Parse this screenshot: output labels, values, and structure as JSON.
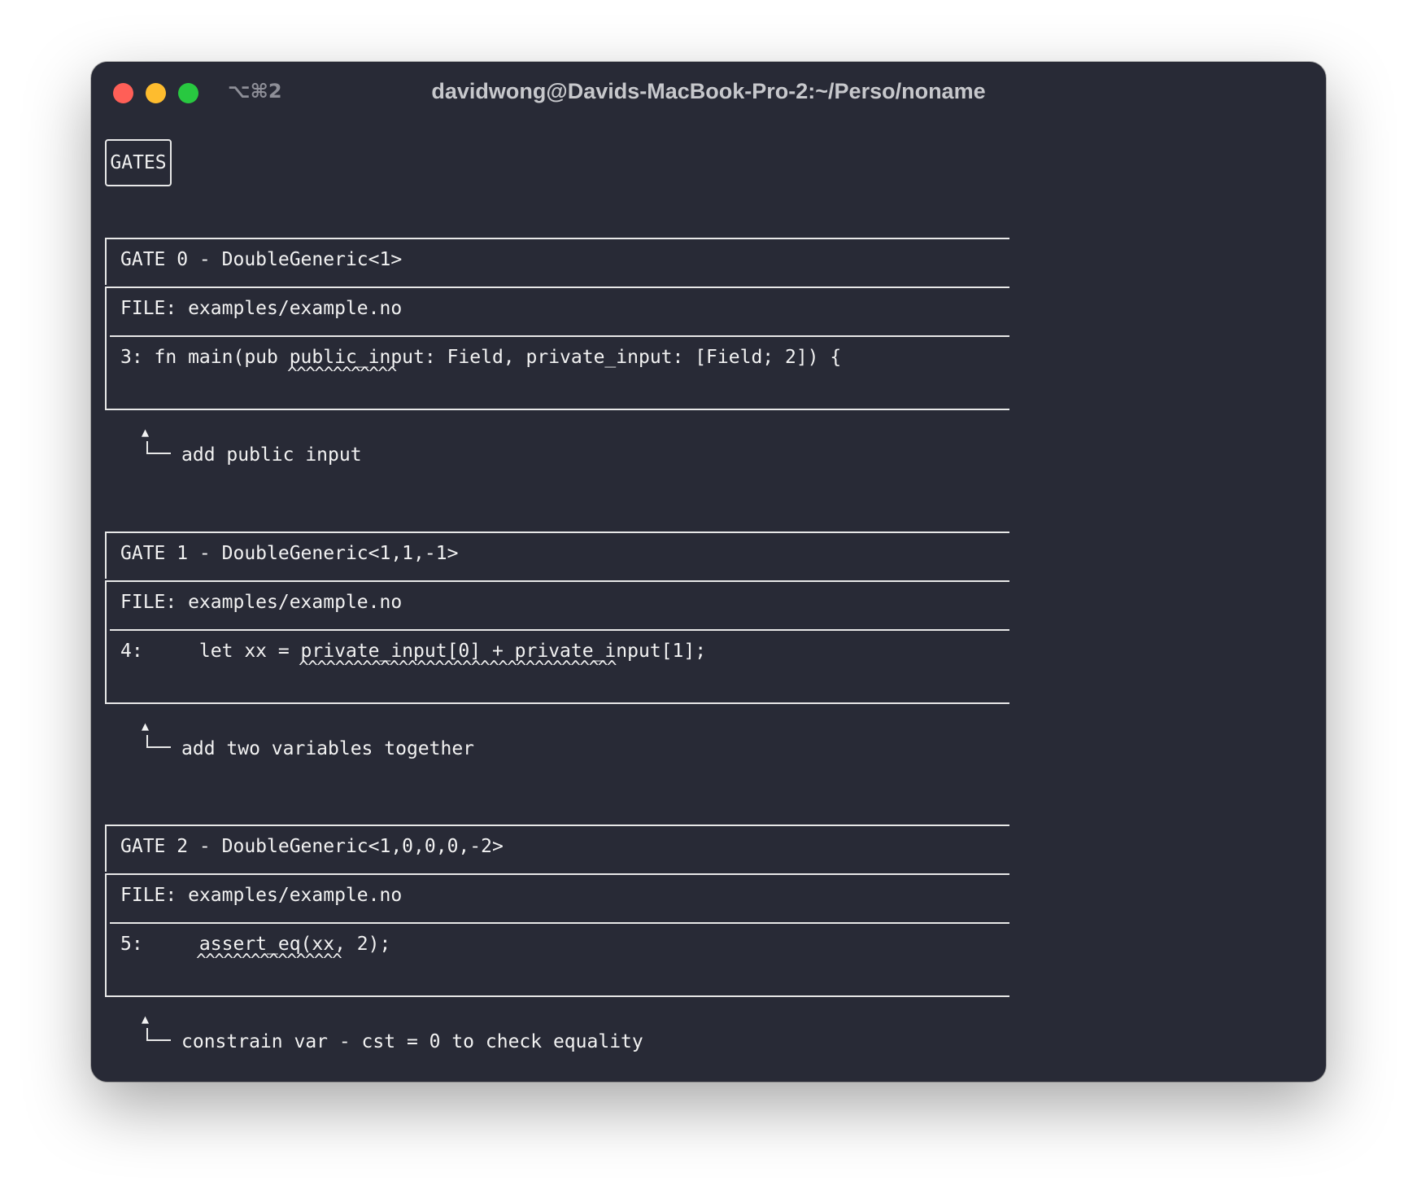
{
  "window": {
    "shortcut": "⌥⌘2",
    "title": "davidwong@Davids-MacBook-Pro-2:~/Perso/noname"
  },
  "tag": "GATES",
  "gates": [
    {
      "header": "GATE 0 - DoubleGeneric<1>",
      "file": "FILE: examples/example.no",
      "code": "3: fn main(pub public_input: Field, private_input: [Field; 2]) {",
      "carets": "^^^^^^^^^^^^",
      "note": "add public input"
    },
    {
      "header": "GATE 1 - DoubleGeneric<1,1,-1>",
      "file": "FILE: examples/example.no",
      "code": "4:     let xx = private_input[0] + private_input[1];",
      "carets": "^^^^^^^^^^^^^^^^^^^^^^^^^^^^^^^^^^^",
      "note": "add two variables together"
    },
    {
      "header": "GATE 2 - DoubleGeneric<1,0,0,0,-2>",
      "file": "FILE: examples/example.no",
      "code": "5:     assert_eq(xx, 2);",
      "carets": "^^^^^^^^^^^^^^^^",
      "note": "constrain var - cst = 0 to check equality"
    }
  ]
}
